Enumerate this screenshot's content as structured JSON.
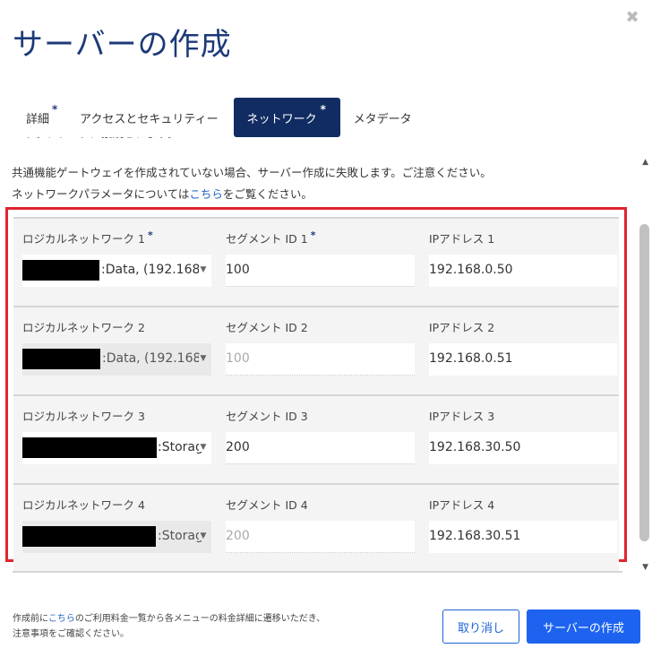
{
  "dialog": {
    "title": "サーバーの作成",
    "close_glyph": "✖"
  },
  "tabs": [
    {
      "label": "詳細",
      "required": "*"
    },
    {
      "label": "アクセスとセキュリティー",
      "required": ""
    },
    {
      "label": "ネットワーク",
      "required": "*"
    },
    {
      "label": "メタデータ",
      "required": ""
    }
  ],
  "notes": {
    "cut_line": "ルネットワークに接続されます。",
    "line2": "共通機能ゲートウェイを作成されていない場合、サーバー作成に失敗します。ご注意ください。",
    "line3_prefix": "ネットワークパラメータについては",
    "line3_link": "こちら",
    "line3_suffix": "をご覧ください。"
  },
  "networks": [
    {
      "network_label": "ロジカルネットワーク 1",
      "network_required": "*",
      "network_value": ":Data, (192.168",
      "segment_label": "セグメント ID 1",
      "segment_required": "*",
      "segment_value": "100",
      "ip_label": "IPアドレス 1",
      "ip_value": "192.168.0.50",
      "disabled": false
    },
    {
      "network_label": "ロジカルネットワーク 2",
      "network_required": "",
      "network_value": ":Data, (192.168",
      "segment_label": "セグメント ID 2",
      "segment_required": "",
      "segment_value": "100",
      "ip_label": "IPアドレス 2",
      "ip_value": "192.168.0.51",
      "disabled": true
    },
    {
      "network_label": "ロジカルネットワーク 3",
      "network_required": "",
      "network_value": ":Storag",
      "segment_label": "セグメント ID 3",
      "segment_required": "",
      "segment_value": "200",
      "ip_label": "IPアドレス 3",
      "ip_value": "192.168.30.50",
      "disabled": false
    },
    {
      "network_label": "ロジカルネットワーク 4",
      "network_required": "",
      "network_value": ":Storag",
      "segment_label": "セグメント ID 4",
      "segment_required": "",
      "segment_value": "200",
      "ip_label": "IPアドレス 4",
      "ip_value": "192.168.30.51",
      "disabled": true
    }
  ],
  "footer": {
    "note_prefix": "作成前に",
    "note_link": "こちら",
    "note_suffix": "のご利用料金一覧から各メニューの料金詳細に遷移いただき、",
    "note_line2": "注意事項をご確認ください。",
    "cancel_label": "取り消し",
    "create_label": "サーバーの作成"
  },
  "colors": {
    "accent": "#1d63f0",
    "tab_active": "#102c62",
    "highlight_border": "#e0242f"
  }
}
